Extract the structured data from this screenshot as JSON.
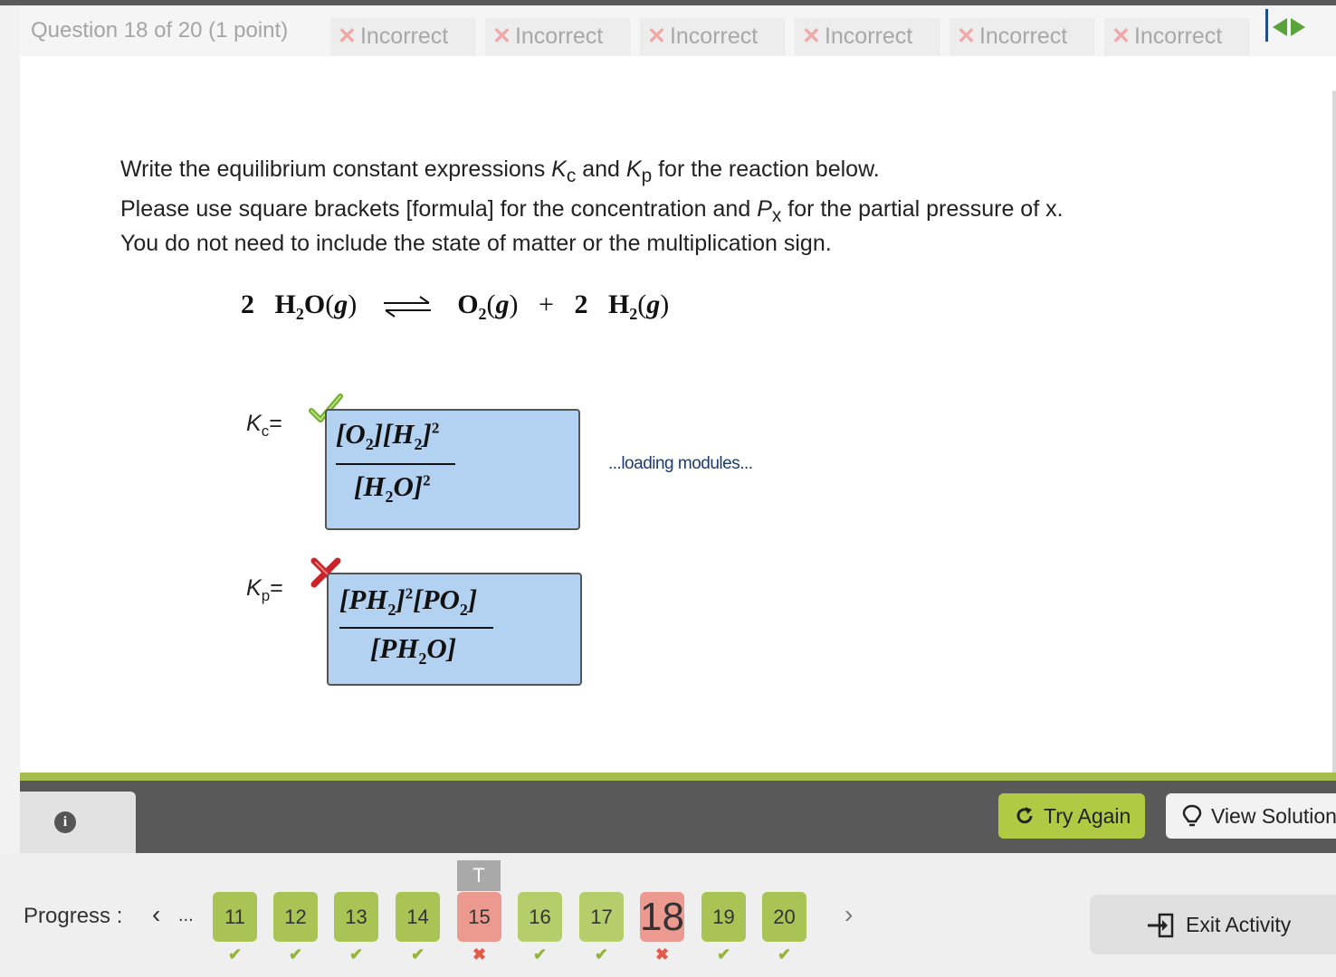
{
  "header": {
    "question_title": "Question 18 of 20 (1 point)",
    "attempts": [
      "Incorrect",
      "Incorrect",
      "Incorrect",
      "Incorrect",
      "Incorrect",
      "Incorrect"
    ],
    "attempt_mark": "✕"
  },
  "question": {
    "line1_a": "Write the equilibrium constant expressions ",
    "line1_k1": "K",
    "line1_k1_sub": "c",
    "line1_and": " and ",
    "line1_k2": "K",
    "line1_k2_sub": "p",
    "line1_end": " for the reaction below.",
    "line2_a": "Please use square brackets [formula] for the concentration and ",
    "line2_p": "P",
    "line2_p_sub": "x",
    "line2_end": " for the partial pressure of x.",
    "line3": "You do not need to include the state of matter or the multiplication sign."
  },
  "reaction": {
    "coef1": "2",
    "r1_a": "H",
    "r1_sub": "2",
    "r1_b": "O",
    "state": "g",
    "p1_a": "O",
    "p1_sub": "2",
    "plus": "+",
    "coef2": "2",
    "p2_a": "H",
    "p2_sub": "2"
  },
  "kc": {
    "label": "K",
    "label_sub": "c",
    "eq": "=",
    "status": "correct",
    "numerator": {
      "a": "[O",
      "a_sub": "2",
      "b": "][H",
      "b_sub": "2",
      "c": "]",
      "c_sup": "2"
    },
    "denominator": {
      "a": "[H",
      "a_sub": "2",
      "b": "O]",
      "b_sup": "2"
    }
  },
  "kp": {
    "label": "K",
    "label_sub": "p",
    "eq": "=",
    "status": "incorrect",
    "numerator": {
      "a": "[PH",
      "a_sub": "2",
      "b": "]",
      "b_sup": "2",
      "c": "[PO",
      "c_sub": "2",
      "d": "]"
    },
    "denominator": {
      "a": "[PH",
      "a_sub": "2",
      "b": "O]"
    }
  },
  "loading_text": "...loading modules...",
  "actions": {
    "try_again": "Try Again",
    "view_solution": "View Solution",
    "info_icon": "i"
  },
  "progress": {
    "label": "Progress :",
    "prev": "‹",
    "ellipsis": "...",
    "next": "›",
    "flag": "T",
    "ok_mark": "✔",
    "bad_mark": "✖",
    "questions": [
      {
        "num": "11",
        "status": "correct"
      },
      {
        "num": "12",
        "status": "correct"
      },
      {
        "num": "13",
        "status": "correct"
      },
      {
        "num": "14",
        "status": "correct"
      },
      {
        "num": "15",
        "status": "incorrect"
      },
      {
        "num": "16",
        "status": "correct"
      },
      {
        "num": "17",
        "status": "correct"
      },
      {
        "num": "18",
        "status": "incorrect"
      },
      {
        "num": "19",
        "status": "correct"
      },
      {
        "num": "20",
        "status": "correct"
      }
    ],
    "exit": "Exit Activity"
  },
  "colors": {
    "accent_green": "#a6be4d",
    "incorrect_red": "#ec9a90",
    "answer_blue": "#b3d1f1"
  }
}
